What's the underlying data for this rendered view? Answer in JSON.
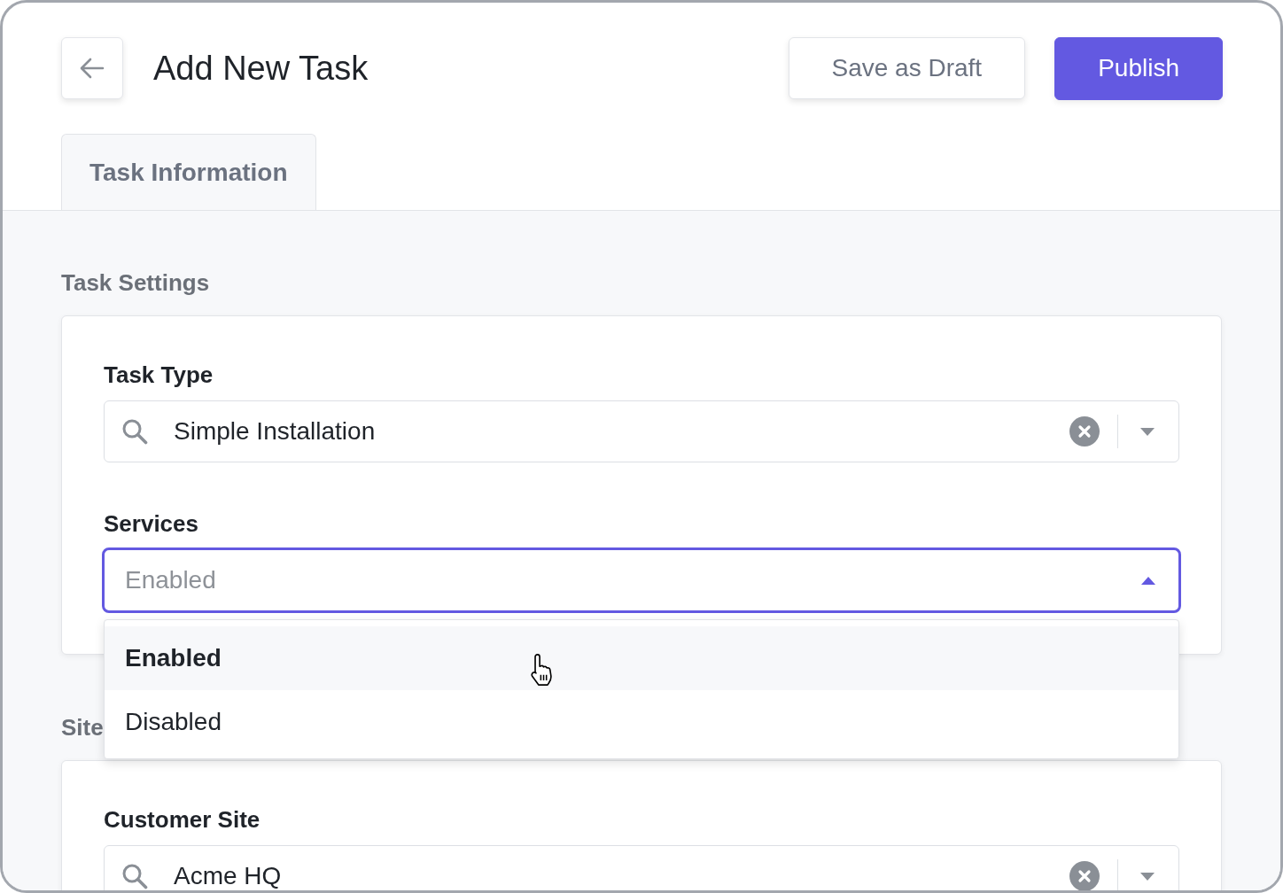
{
  "header": {
    "title": "Add New Task",
    "buttons": [
      {
        "label": "Save as Draft",
        "kind": "secondary"
      },
      {
        "label": "Publish",
        "kind": "primary"
      }
    ]
  },
  "tabs": [
    {
      "label": "Task Information",
      "selected": true
    }
  ],
  "sections": [
    {
      "title": "Task Settings",
      "fields": [
        {
          "label": "Task Type",
          "kind": "search-select",
          "value": "Simple Installation",
          "expanded": false
        },
        {
          "label": "Services",
          "kind": "select",
          "placeholder": "Enabled",
          "expanded": true,
          "options": [
            {
              "label": "Enabled",
              "selected": true
            },
            {
              "label": "Disabled",
              "selected": false
            }
          ]
        }
      ]
    },
    {
      "title": "Site",
      "fields": [
        {
          "label": "Customer Site",
          "kind": "search-select",
          "value": "Acme HQ",
          "expanded": false
        }
      ]
    }
  ]
}
